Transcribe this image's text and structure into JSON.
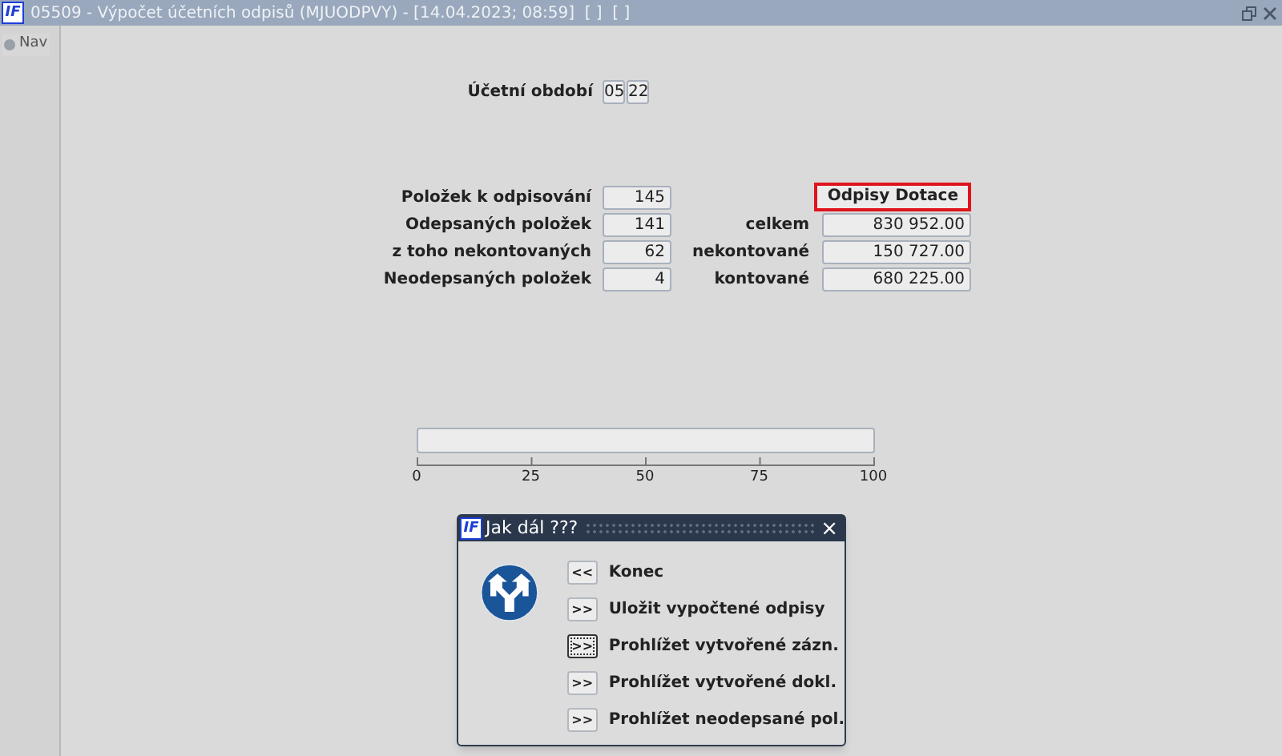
{
  "window": {
    "title": "05509 - Výpočet účetních odpisů (MJUODPVY) - [14.04.2023; 08:59]  [ ]  [ ]",
    "logo": "IF"
  },
  "sidebar": {
    "nav_label": "Nav"
  },
  "period": {
    "label": "Účetní období",
    "month": "05",
    "year": "22"
  },
  "counts": [
    {
      "label": "Položek k odpisování",
      "value": "145"
    },
    {
      "label": "Odepsaných položek",
      "value": "141"
    },
    {
      "label": "z toho nekontovaných",
      "value": "62"
    },
    {
      "label": "Neodepsaných položek",
      "value": "4"
    }
  ],
  "amounts": {
    "title": "Odpisy Dotace",
    "rows": [
      {
        "label": "celkem",
        "value": "830 952.00"
      },
      {
        "label": "nekontované",
        "value": "150 727.00"
      },
      {
        "label": "kontované",
        "value": "680 225.00"
      }
    ]
  },
  "progress": {
    "level": 0,
    "ticks": [
      "0",
      "25",
      "50",
      "75",
      "100"
    ]
  },
  "dialog": {
    "title": "Jak dál ???",
    "logo": "IF",
    "close": "×",
    "options": [
      {
        "button": "<<",
        "label": "Konec",
        "focused": false
      },
      {
        "button": ">>",
        "label": "Uložit vypočtené odpisy",
        "focused": false
      },
      {
        "button": ">>",
        "label": "Prohlížet vytvořené zázn.",
        "focused": true
      },
      {
        "button": ">>",
        "label": "Prohlížet vytvořené dokl.",
        "focused": false
      },
      {
        "button": ">>",
        "label": "Prohlížet neodepsané pol.",
        "focused": false
      }
    ]
  }
}
